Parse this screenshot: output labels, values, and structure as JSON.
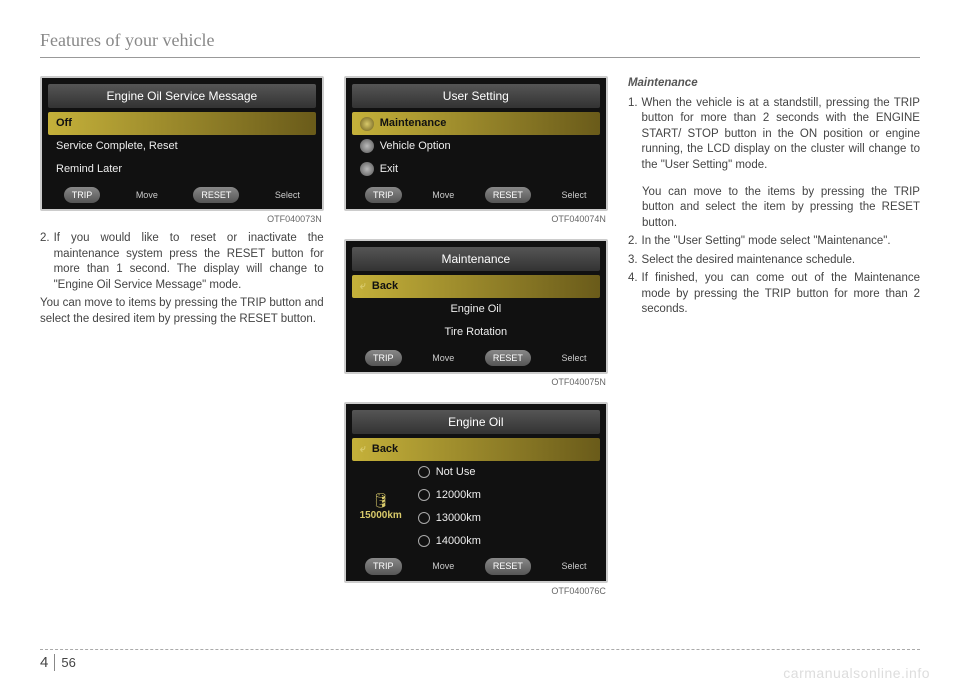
{
  "header": {
    "title": "Features of your vehicle"
  },
  "footer": {
    "chapter": "4",
    "page": "56"
  },
  "watermark": "carmanualsonline.info",
  "col1": {
    "lcd1": {
      "title": "Engine Oil Service Message",
      "row_hl": "Off",
      "row2": "Service Complete, Reset",
      "row3": "Remind Later",
      "foot_trip": "TRIP",
      "foot_move": "Move",
      "foot_reset": "RESET",
      "foot_select": "Select",
      "code": "OTF040073N"
    },
    "para_num": "2.",
    "para1": "If you would like to reset or inactivate the maintenance system press the RESET button for more than 1 second. The display will change to \"Engine Oil Service Message\" mode.",
    "para2": "You can move to items by pressing the TRIP button and select the desired item by pressing the RESET button."
  },
  "col2": {
    "lcd2": {
      "title": "User Setting",
      "row_hl": "Maintenance",
      "row2": "Vehicle Option",
      "row3": "Exit",
      "foot_trip": "TRIP",
      "foot_move": "Move",
      "foot_reset": "RESET",
      "foot_select": "Select",
      "code": "OTF040074N"
    },
    "lcd3": {
      "title": "Maintenance",
      "row_hl": "Back",
      "row2": "Engine Oil",
      "row3": "Tire Rotation",
      "foot_trip": "TRIP",
      "foot_move": "Move",
      "foot_reset": "RESET",
      "foot_select": "Select",
      "code": "OTF040075N"
    },
    "lcd4": {
      "title": "Engine Oil",
      "row_hl": "Back",
      "opt1": "Not Use",
      "opt2": "12000km",
      "opt3": "13000km",
      "opt4": "14000km",
      "side": "15000km",
      "foot_trip": "TRIP",
      "foot_move": "Move",
      "foot_reset": "RESET",
      "foot_select": "Select",
      "code": "OTF040076C"
    }
  },
  "col3": {
    "heading": "Maintenance",
    "p1_num": "1.",
    "p1": "When the vehicle is at a standstill, pressing the TRIP button for more than 2 seconds with the ENGINE START/ STOP button in the ON position or engine running, the LCD display on the cluster will change to the \"User Setting\" mode.",
    "p1b": "You can move to the items by pressing the TRIP button and select the item by pressing the RESET button.",
    "p2_num": "2.",
    "p2": "In the \"User Setting\" mode select \"Maintenance\".",
    "p3_num": "3.",
    "p3": "Select the desired maintenance schedule.",
    "p4_num": "4.",
    "p4": "If finished, you can come out of the Maintenance mode by pressing the TRIP button for more than 2 seconds."
  }
}
